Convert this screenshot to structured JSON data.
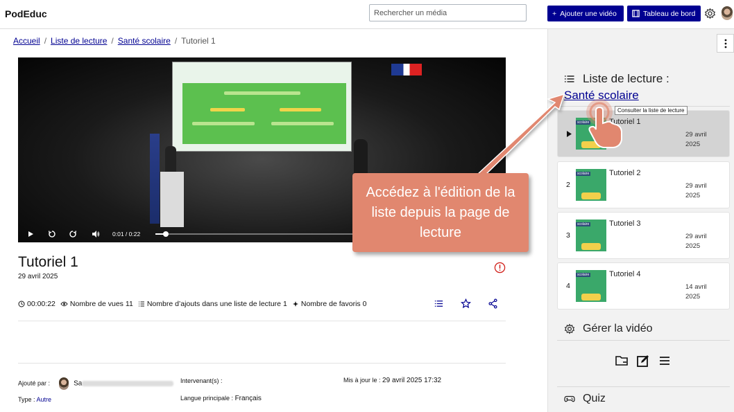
{
  "app": {
    "name": "PodEduc"
  },
  "search": {
    "placeholder": "Rechercher un média"
  },
  "header": {
    "add_video_label": "Ajouter une vidéo",
    "dashboard_label": "Tableau de bord",
    "add_icon": "plus-icon",
    "dashboard_icon": "film-icon",
    "settings_icon": "gear-icon",
    "primary_color": "#000091"
  },
  "breadcrumb": {
    "items": [
      "Accueil",
      "Liste de lecture",
      "Santé scolaire"
    ],
    "current": "Tutoriel 1",
    "separator": "/"
  },
  "player": {
    "time_current": "0:01",
    "time_separator": "/",
    "time_total": "0:22",
    "progress_fraction": 0.05
  },
  "video": {
    "title": "Tutoriel 1",
    "date": "29 avril 2025",
    "duration": "00:00:22",
    "views_label": "Nombre de vues",
    "views": "11",
    "adds_label": "Nombre d’ajouts dans une liste de lecture",
    "adds": "1",
    "favorites_label": "Nombre de favoris",
    "favorites": "0"
  },
  "details": {
    "added_by_label": "Ajouté par :",
    "added_by_name": "Sa",
    "speakers_label": "Intervenant(s) :",
    "updated_label": "Mis à jour le :",
    "updated_value": "29 avril 2025 17:32",
    "type_label": "Type :",
    "type_value": "Autre",
    "language_label": "Langue principale :",
    "language_value": "Français"
  },
  "playlist": {
    "heading": "Liste de lecture :",
    "name": "Santé scolaire",
    "tooltip": "Consulter la liste de lecture",
    "items": [
      {
        "num": "",
        "title": "Tutoriel 1",
        "date_line1": "29 avril",
        "date_line2": "2025",
        "active": true
      },
      {
        "num": "2",
        "title": "Tutoriel 2",
        "date_line1": "29 avril",
        "date_line2": "2025",
        "active": false
      },
      {
        "num": "3",
        "title": "Tutoriel 3",
        "date_line1": "29 avril",
        "date_line2": "2025",
        "active": false
      },
      {
        "num": "4",
        "title": "Tutoriel 4",
        "date_line1": "14 avril",
        "date_line2": "2025",
        "active": false
      }
    ],
    "thumb_tag": "scolaire"
  },
  "manage": {
    "heading": "Gérer la vidéo"
  },
  "quiz": {
    "heading": "Quiz"
  },
  "annotation": {
    "text": "Accédez à l'édition de la liste depuis la page de lecture",
    "color": "#e1876f"
  }
}
